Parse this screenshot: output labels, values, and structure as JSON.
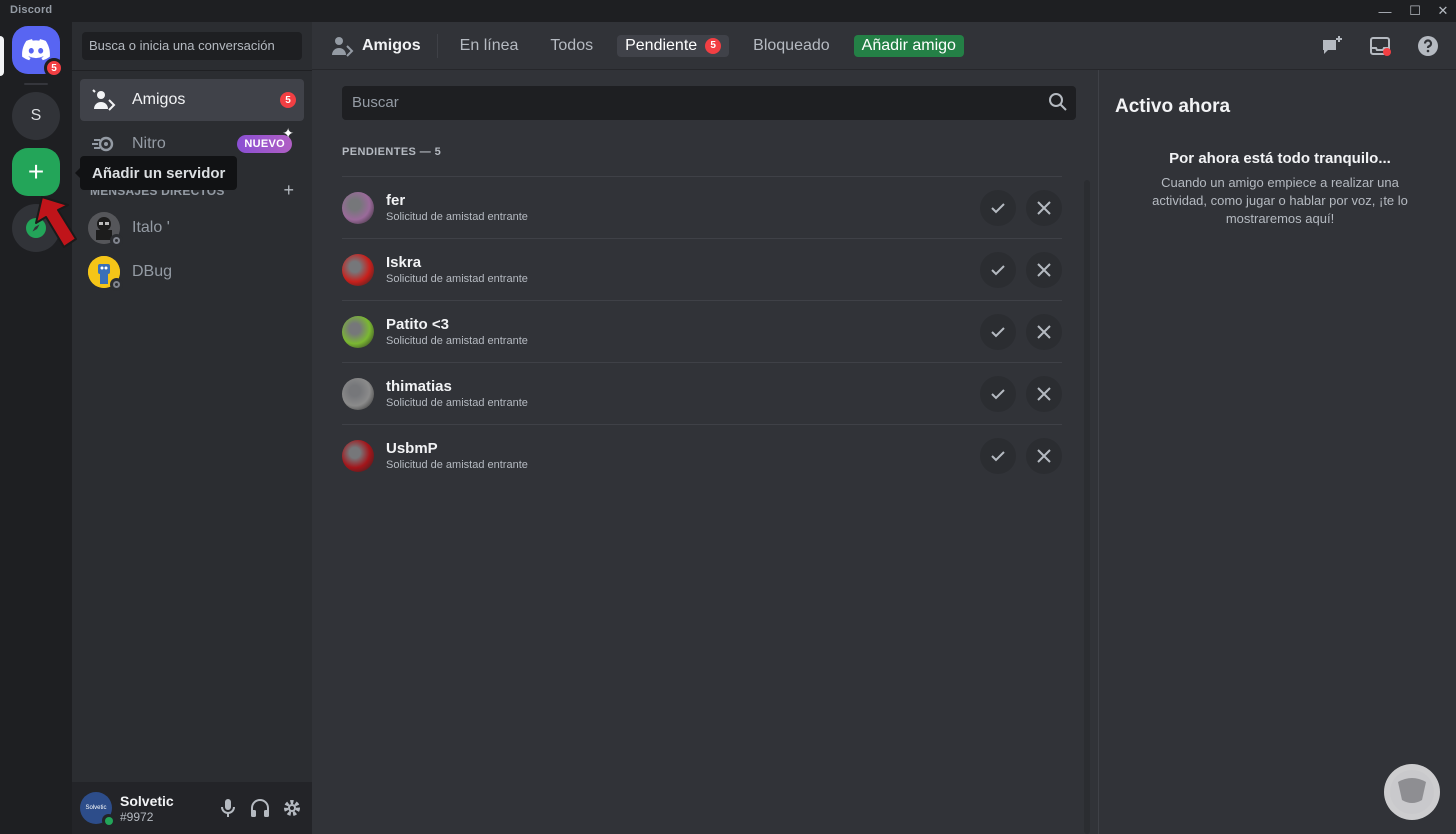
{
  "window": {
    "app_title": "Discord",
    "min_glyph": "—",
    "max_glyph": "☐",
    "close_glyph": "✕"
  },
  "servers": {
    "home_badge": "5",
    "server_s_label": "S",
    "add_glyph": "+",
    "tooltip": "Añadir un servidor"
  },
  "sidebar": {
    "search_placeholder": "Busca o inicia una conversación",
    "friends_label": "Amigos",
    "friends_badge": "5",
    "nitro_label": "Nitro",
    "nitro_badge": "NUEVO",
    "dm_header": "MENSAJES DIRECTOS",
    "dm_add": "+",
    "dms": [
      {
        "name": "Italo '"
      },
      {
        "name": "DBug"
      }
    ]
  },
  "user": {
    "name": "Solvetic",
    "tag": "#9972",
    "avatar_text": "Solvetic"
  },
  "header": {
    "title": "Amigos",
    "tabs": {
      "online": "En línea",
      "all": "Todos",
      "pending": "Pendiente",
      "pending_badge": "5",
      "blocked": "Bloqueado",
      "add_friend": "Añadir amigo"
    }
  },
  "main": {
    "search_placeholder": "Buscar",
    "section_label": "PENDIENTES — 5",
    "requests": [
      {
        "name": "fer",
        "subtitle": "Solicitud de amistad entrante",
        "avatar_color": "#9a6a9a"
      },
      {
        "name": "Iskra",
        "subtitle": "Solicitud de amistad entrante",
        "avatar_color": "#c8201c"
      },
      {
        "name": "Patito <3",
        "subtitle": "Solicitud de amistad entrante",
        "avatar_color": "#7bb832"
      },
      {
        "name": "thimatias",
        "subtitle": "Solicitud de amistad entrante",
        "avatar_color": "#8b8b8b"
      },
      {
        "name": "UsbmP",
        "subtitle": "Solicitud de amistad entrante",
        "avatar_color": "#a3151a"
      }
    ]
  },
  "active_now": {
    "title": "Activo ahora",
    "empty_title": "Por ahora está todo tranquilo...",
    "empty_desc": "Cuando un amigo empiece a realizar una actividad, como jugar o hablar por voz, ¡te lo mostraremos aquí!"
  },
  "colors": {
    "blurple": "#5865f2",
    "green": "#23a559",
    "red": "#f23f43"
  }
}
